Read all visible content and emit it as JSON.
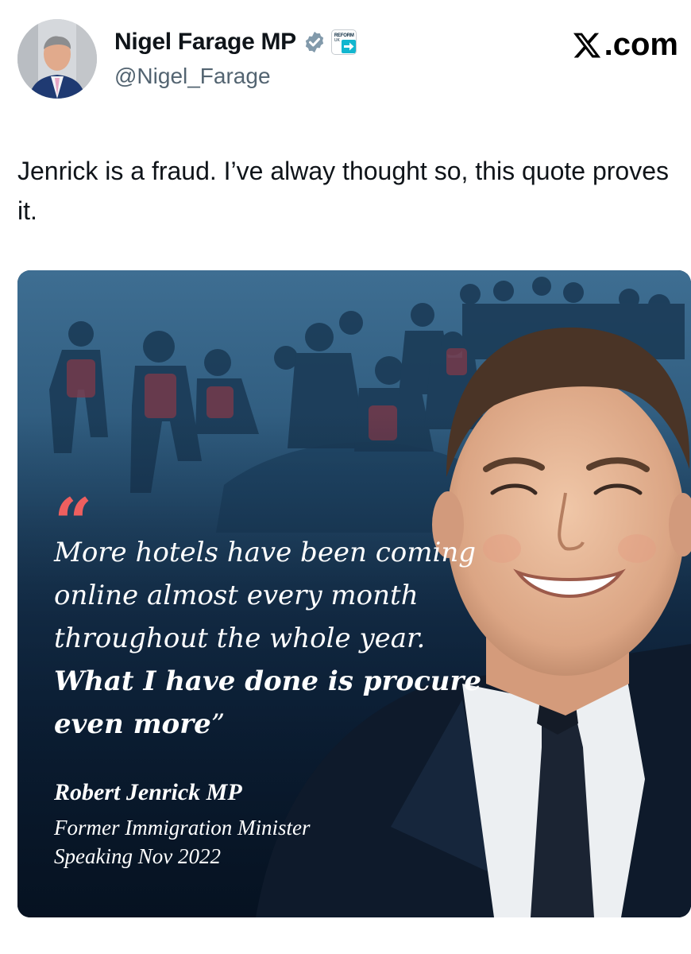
{
  "author": {
    "display_name": "Nigel Farage MP",
    "handle": "@Nigel_Farage",
    "avatar_icon": "profile-photo",
    "verified_icon": "verified-badge-icon",
    "affiliate_badge": {
      "line1": "REFORM",
      "line2": "UK"
    }
  },
  "brand": {
    "logo_icon": "x-logo-icon",
    "suffix": ".com"
  },
  "tweet": {
    "text": "Jenrick is a fraud. I’ve alway thought so, this quote proves it."
  },
  "media": {
    "open_quote": "“",
    "quote_regular": "More hotels have been coming online almost every month throughout the whole year. ",
    "quote_bold": "What I have done is procure even more",
    "close_quote": "”",
    "attribution_name": "Robert Jenrick MP",
    "attribution_role": "Former Immigration Minister",
    "attribution_date": "Speaking Nov 2022",
    "colors": {
      "quote_mark": "#ee5f5f",
      "background": "#0d2036"
    }
  }
}
